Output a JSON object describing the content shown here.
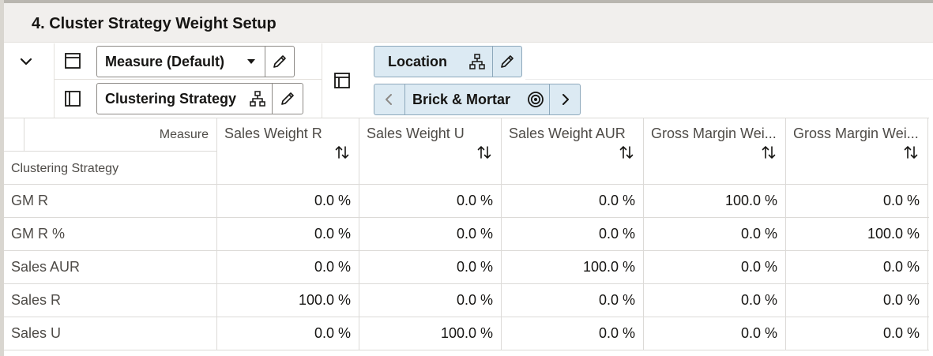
{
  "page": {
    "title": "4. Cluster Strategy Weight Setup"
  },
  "icons": {
    "collapse": "chevron-down-icon",
    "rows_layout": "rows-layout-icon",
    "columns_layout": "columns-layout-icon",
    "pivot": "pivot-icon",
    "hierarchy": "hierarchy-icon",
    "edit": "pencil-icon",
    "target": "target-icon",
    "sort": "sort-icon"
  },
  "colors": {
    "tile_blue": "#dceaf3",
    "header_bg": "#f1efed"
  },
  "toolbar": {
    "measure_tile": {
      "label": "Measure (Default)"
    },
    "strategy_tile": {
      "label": "Clustering Strategy"
    },
    "location_tile": {
      "label": "Location"
    },
    "brick_tile": {
      "label": "Brick & Mortar"
    }
  },
  "grid": {
    "corner": {
      "measure_label": "Measure",
      "row_dim_label": "Clustering Strategy"
    },
    "columns": [
      "Sales Weight R",
      "Sales Weight U",
      "Sales Weight AUR",
      "Gross Margin Wei...",
      "Gross Margin Wei..."
    ],
    "rows": [
      {
        "label": "GM R",
        "values": [
          "0.0 %",
          "0.0 %",
          "0.0 %",
          "100.0 %",
          "0.0 %"
        ]
      },
      {
        "label": "GM R %",
        "values": [
          "0.0 %",
          "0.0 %",
          "0.0 %",
          "0.0 %",
          "100.0 %"
        ]
      },
      {
        "label": "Sales AUR",
        "values": [
          "0.0 %",
          "0.0 %",
          "100.0 %",
          "0.0 %",
          "0.0 %"
        ]
      },
      {
        "label": "Sales R",
        "values": [
          "100.0 %",
          "0.0 %",
          "0.0 %",
          "0.0 %",
          "0.0 %"
        ]
      },
      {
        "label": "Sales U",
        "values": [
          "0.0 %",
          "100.0 %",
          "0.0 %",
          "0.0 %",
          "0.0 %"
        ]
      }
    ]
  }
}
